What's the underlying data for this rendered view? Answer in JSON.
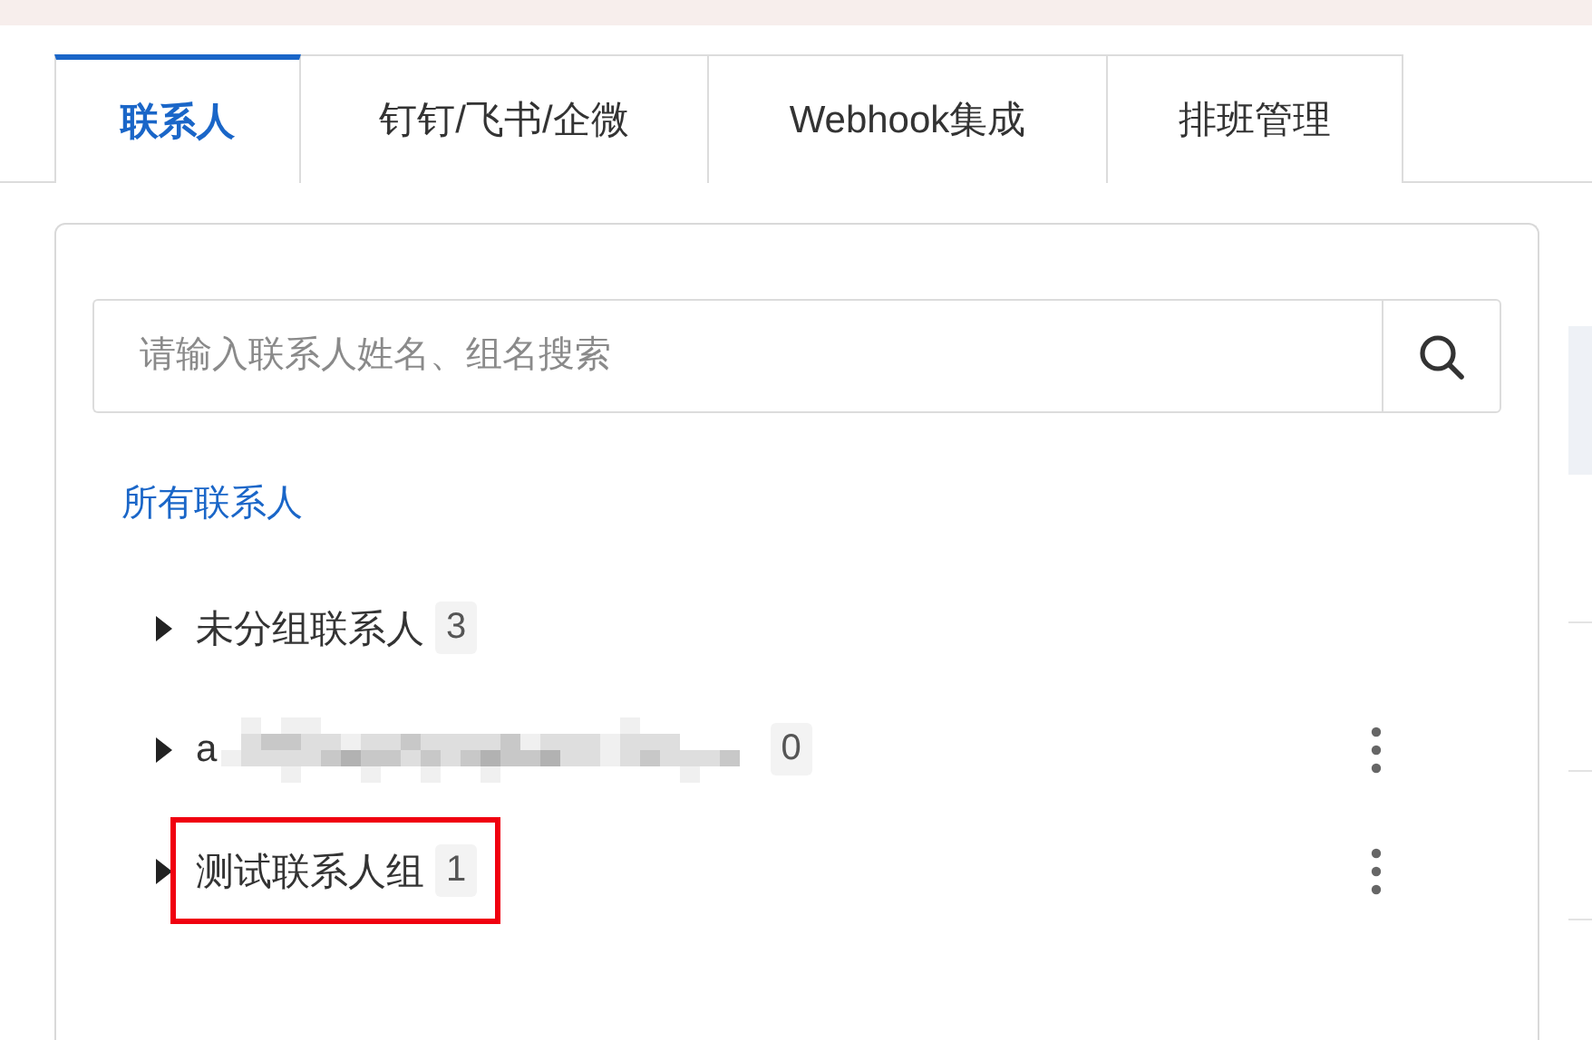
{
  "tabs": [
    {
      "label": "联系人",
      "selected": true
    },
    {
      "label": "钉钉/飞书/企微",
      "selected": false
    },
    {
      "label": "Webhook集成",
      "selected": false
    },
    {
      "label": "排班管理",
      "selected": false
    }
  ],
  "search": {
    "placeholder": "请输入联系人姓名、组名搜索"
  },
  "all_contacts_link": "所有联系人",
  "groups": [
    {
      "name": "未分组联系人",
      "count": "3",
      "expanded": false,
      "redacted": false,
      "has_menu": false,
      "highlighted": false
    },
    {
      "name": "a",
      "count": "0",
      "expanded": false,
      "redacted": true,
      "has_menu": true,
      "highlighted": false
    },
    {
      "name": "测试联系人组",
      "count": "1",
      "expanded": false,
      "redacted": false,
      "has_menu": true,
      "highlighted": true
    }
  ]
}
